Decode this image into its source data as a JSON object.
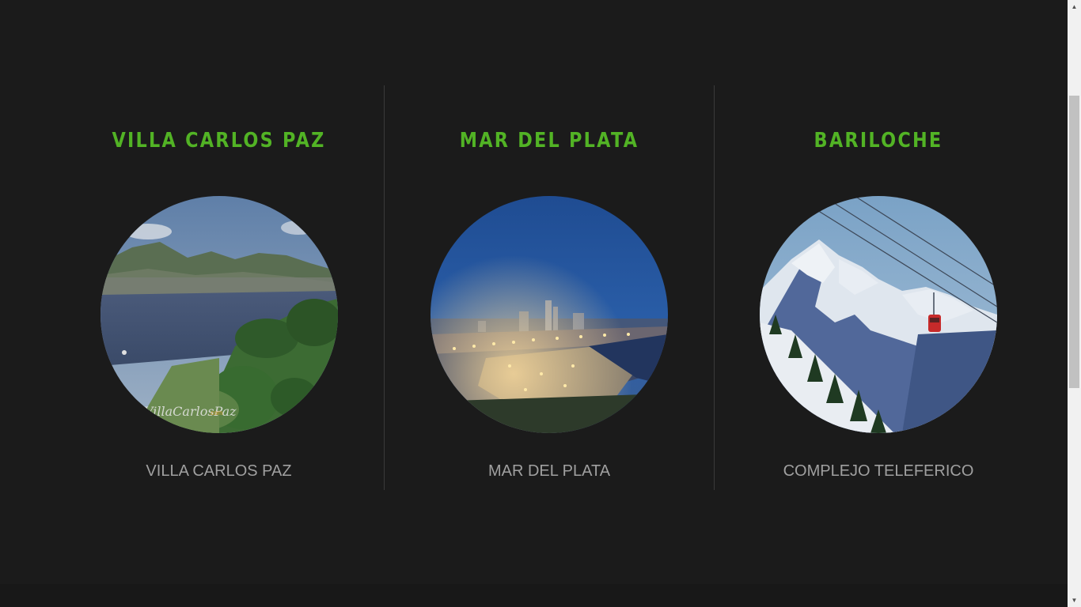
{
  "destinations": [
    {
      "title": "VILLA CARLOS PAZ",
      "caption": "VILLA CARLOS PAZ",
      "image_icon": "lake-town-photo",
      "watermark": "VillaCarlosPaz.com"
    },
    {
      "title": "MAR DEL PLATA",
      "caption": "MAR DEL PLATA",
      "image_icon": "night-coast-city-photo"
    },
    {
      "title": "BARILOCHE",
      "caption": "COMPLEJO TELEFERICO",
      "image_icon": "snowy-mountain-cable-car-photo"
    }
  ],
  "colors": {
    "background": "#1b1b1b",
    "title_green": "#52b325",
    "caption_gray": "#a0a0a0",
    "divider": "#3a3a3a"
  },
  "scrollbar": {
    "up_icon": "▲",
    "down_icon": "▼"
  }
}
